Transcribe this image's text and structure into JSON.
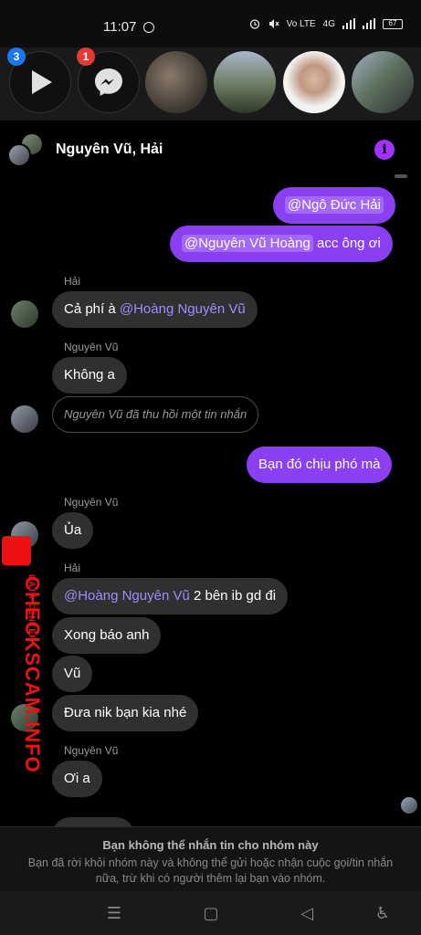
{
  "status_bar": {
    "time": "11:07",
    "indicators": [
      "alarm-icon",
      "mute-icon",
      "VoLTE",
      "4G",
      "signal-icon",
      "signal-icon"
    ],
    "volte": "Vo LTE",
    "network": "4G",
    "battery": "67"
  },
  "chat_heads": {
    "badges": [
      "3",
      "1"
    ],
    "items": [
      "play-app-icon",
      "messenger-app-icon",
      "contact-photo",
      "contact-photo",
      "contact-photo",
      "contact-photo"
    ]
  },
  "header": {
    "title": "Nguyên Vũ, Hải",
    "info_icon": "i"
  },
  "messages": {
    "m1": {
      "mention": "@Ngô Đức Hải"
    },
    "m2": {
      "mention": "@Nguyên Vũ Hoàng",
      "text": " acc ông ơi"
    },
    "hai1": {
      "sender": "Hải",
      "text": "Cả phí à ",
      "mention": "@Hoàng Nguyên Vũ"
    },
    "vu1": {
      "sender": "Nguyên Vũ",
      "text": "Không a",
      "unsent": "Nguyên Vũ đã thu hồi một tin nhắn"
    },
    "m3": {
      "text": "Bạn đó chịu phó mà"
    },
    "vu2": {
      "sender": "Nguyên Vũ",
      "text": "Ủa"
    },
    "hai2": {
      "sender": "Hải",
      "mention": "@Hoàng Nguyên Vũ",
      "text1": " 2 bên ib gd đi",
      "text2": "Xong báo anh",
      "text3": "Vũ",
      "text4": "Đưa nik bạn kia nhé"
    },
    "vu3": {
      "sender": "Nguyên Vũ",
      "text": "Ơi a"
    }
  },
  "watermark": {
    "main": "CHECKSCAM.INFO",
    "sub": "DATA CENTER"
  },
  "footer": {
    "title": "Bạn không thể nhắn tin cho nhóm này",
    "body": "Bạn đã rời khỏi nhóm này và không thể gửi hoặc nhận cuộc gọi/tin nhắn nữa, trừ khi có người thêm lại bạn vào nhóm."
  },
  "navbar": {
    "buttons": [
      "menu-icon",
      "home-icon",
      "back-icon",
      "accessibility-icon"
    ],
    "glyphs": {
      "menu": "☰",
      "home": "▢",
      "back": "◁",
      "accessibility": "♿"
    }
  },
  "colors": {
    "accent": "#8a3ff2",
    "incoming_bubble": "#303030",
    "mention_incoming": "#a08bff",
    "badge_blue": "#1877f2",
    "badge_red": "#e53935",
    "watermark": "#e11111"
  }
}
